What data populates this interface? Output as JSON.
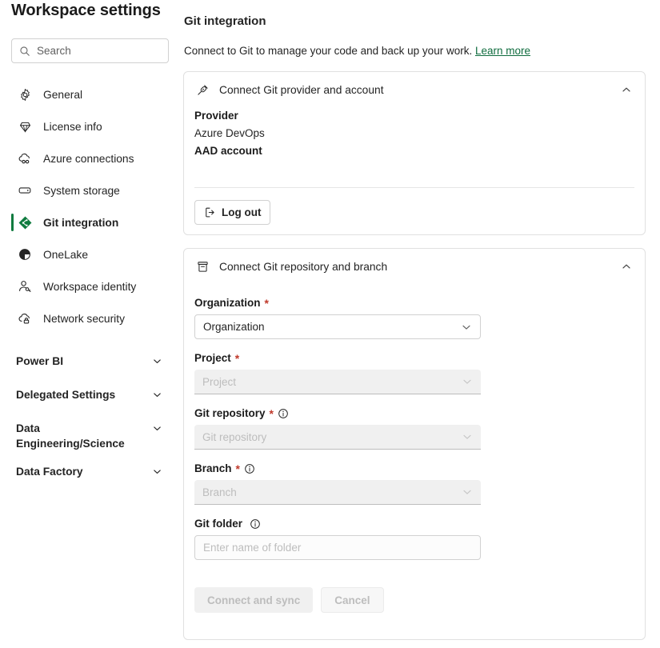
{
  "page": {
    "title": "Workspace settings",
    "clipped_heading": "Git integration"
  },
  "colors": {
    "accent_green": "#0f7b3f",
    "link_green": "#0f6c3e",
    "required_red": "#c0392b",
    "border": "#e0e0e0",
    "disabled_text": "#bdbdbd",
    "disabled_bg": "#f0f0f0"
  },
  "sidebar": {
    "search": {
      "placeholder": "Search",
      "value": "",
      "icon": "search-icon"
    },
    "items": [
      {
        "label": "General",
        "icon": "gear-icon",
        "selected": false
      },
      {
        "label": "License info",
        "icon": "diamond-icon",
        "selected": false
      },
      {
        "label": "Azure connections",
        "icon": "cloud-link-icon",
        "selected": false
      },
      {
        "label": "System storage",
        "icon": "storage-icon",
        "selected": false
      },
      {
        "label": "Git integration",
        "icon": "git-branch-diamond-icon",
        "selected": true
      },
      {
        "label": "OneLake",
        "icon": "onelake-icon",
        "selected": false
      },
      {
        "label": "Workspace identity",
        "icon": "person-key-icon",
        "selected": false
      },
      {
        "label": "Network security",
        "icon": "cloud-lock-icon",
        "selected": false
      }
    ],
    "groups": [
      {
        "label": "Power BI",
        "icon": "chevron-down-icon",
        "expanded": false
      },
      {
        "label": "Delegated Settings",
        "icon": "chevron-down-icon",
        "expanded": false
      },
      {
        "label": "Data Engineering/Science",
        "icon": "chevron-down-icon",
        "expanded": false
      },
      {
        "label": "Data Factory",
        "icon": "chevron-down-icon",
        "expanded": false
      }
    ]
  },
  "main": {
    "description": "Connect to Git to manage your code and back up your work.",
    "learn_more": "Learn more",
    "provider_card": {
      "icon": "plug-connector-icon",
      "title": "Connect Git provider and account",
      "collapse_icon": "chevron-up-icon",
      "provider_label": "Provider",
      "provider_value": "Azure DevOps",
      "account_label": "AAD account",
      "account_value": "",
      "logout_button": "Log out",
      "logout_icon": "sign-out-icon"
    },
    "repo_card": {
      "icon": "archive-box-icon",
      "title": "Connect Git repository and branch",
      "collapse_icon": "chevron-up-icon",
      "fields": [
        {
          "label": "Organization",
          "required": true,
          "has_info": false,
          "type": "dropdown",
          "value": "Organization",
          "disabled": false
        },
        {
          "label": "Project",
          "required": true,
          "has_info": false,
          "type": "dropdown",
          "value": "Project",
          "disabled": true
        },
        {
          "label": "Git repository",
          "required": true,
          "has_info": true,
          "type": "dropdown",
          "value": "Git repository",
          "disabled": true
        },
        {
          "label": "Branch",
          "required": true,
          "has_info": true,
          "type": "dropdown",
          "value": "Branch",
          "disabled": true
        },
        {
          "label": "Git folder",
          "required": false,
          "has_info": true,
          "type": "text",
          "value": "",
          "placeholder": "Enter name of folder",
          "disabled": false
        }
      ],
      "primary_button": "Connect and sync",
      "secondary_button": "Cancel",
      "primary_disabled": true,
      "secondary_disabled": true
    }
  }
}
